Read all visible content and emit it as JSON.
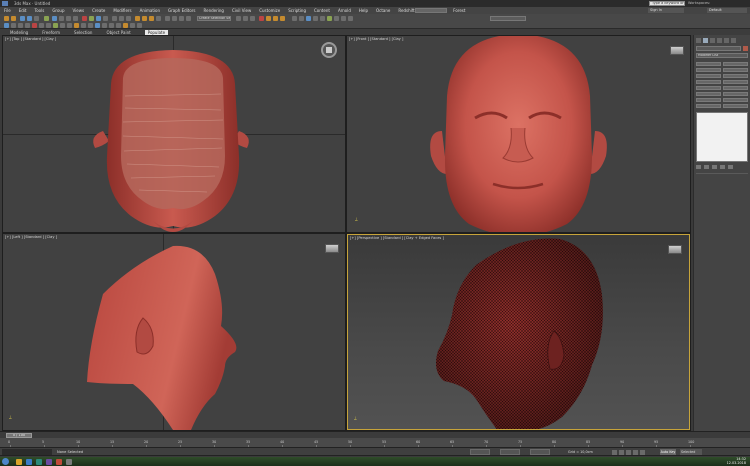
{
  "window": {
    "title": "3ds Max · Untitled",
    "search_placeholder": "Type a keyword or phrase",
    "workspace_label": "Workspaces:",
    "workspace_value": "Default",
    "user_label": "Sign In"
  },
  "menu": [
    "File",
    "Edit",
    "Tools",
    "Group",
    "Views",
    "Create",
    "Modifiers",
    "Animation",
    "Graph Editors",
    "Rendering",
    "Civil View",
    "Customize",
    "Scripting",
    "Content",
    "Arnold",
    "Help",
    "Octane",
    "Redshift",
    "Phoenix FD",
    "Forest"
  ],
  "toolbar": {
    "selection_filter": "Create Selection Se"
  },
  "ribbon": {
    "tabs": [
      "Modeling",
      "Freeform",
      "Selection",
      "Object Paint",
      "Populate"
    ],
    "active_index": 4
  },
  "viewports": {
    "top": {
      "label": "[+] [Top ] [Standard ] [Clay ]"
    },
    "front": {
      "label": "[+] [Front ] [Standard ] [Clay ]"
    },
    "left": {
      "label": "[+] [Left ] [Standard ] [Clay ]"
    },
    "perspective": {
      "label": "[+] [Perspective ] [Standard ] [Clay + Edged Faces ]"
    }
  },
  "command_panel": {
    "modifier_list": "Modifier List",
    "object_color": "#b05a4a"
  },
  "timeline": {
    "slider": "0 / 100",
    "ticks": [
      "0",
      "5",
      "10",
      "15",
      "20",
      "25",
      "30",
      "35",
      "40",
      "45",
      "50",
      "55",
      "60",
      "65",
      "70",
      "75",
      "80",
      "85",
      "90",
      "95",
      "100"
    ]
  },
  "status": {
    "message": "None Selected",
    "grid": "Grid = 10,0cm",
    "auto_key": "Auto Key",
    "key_filter": "Selected"
  },
  "taskbar": {
    "time": "14:32",
    "date": "12.03.2018"
  },
  "colors": {
    "clay": "#c4544a",
    "active_viewport_border": "#c7a43a"
  }
}
